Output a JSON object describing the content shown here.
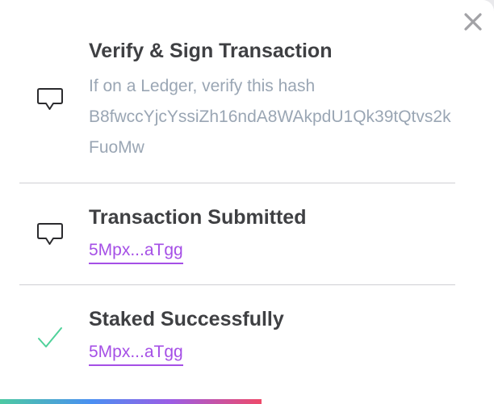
{
  "modal": {
    "close_icon": "close-icon",
    "steps": [
      {
        "icon": "speech-bubble-icon",
        "title": "Verify & Sign Transaction",
        "subtitle": "If on a Ledger, verify this hash",
        "hash": "B8fwccYjcYssiZh16ndA8WAkpdU1Qk39tQtvs2kFuoMw"
      },
      {
        "icon": "speech-bubble-icon",
        "title": "Transaction Submitted",
        "link": "5Mpx...aTgg"
      },
      {
        "icon": "checkmark-icon",
        "title": "Staked Successfully",
        "link": "5Mpx...aTgg"
      }
    ],
    "progress_fraction": 0.53
  },
  "colors": {
    "title": "#3f4043",
    "muted": "#9aa6b4",
    "link": "#a54fe6",
    "success": "#4fd19a",
    "divider": "#cfcfd3"
  }
}
